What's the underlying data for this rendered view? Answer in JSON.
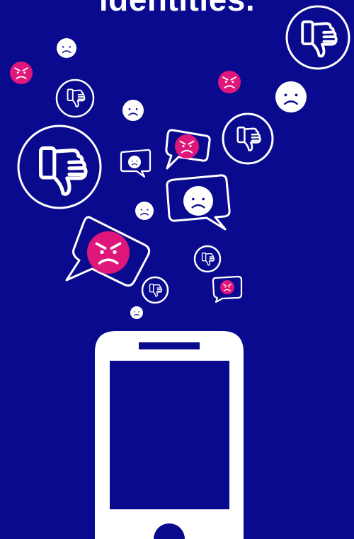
{
  "headline": "identities.",
  "colors": {
    "background": "#0a0a8f",
    "line": "#ffffff",
    "angry_face": "#e0177a",
    "sad_face": "#ffffff"
  },
  "icons": [
    "thumbs-down-icon",
    "sad-face-icon",
    "angry-face-icon",
    "speech-bubble-icon",
    "smartphone-icon"
  ]
}
